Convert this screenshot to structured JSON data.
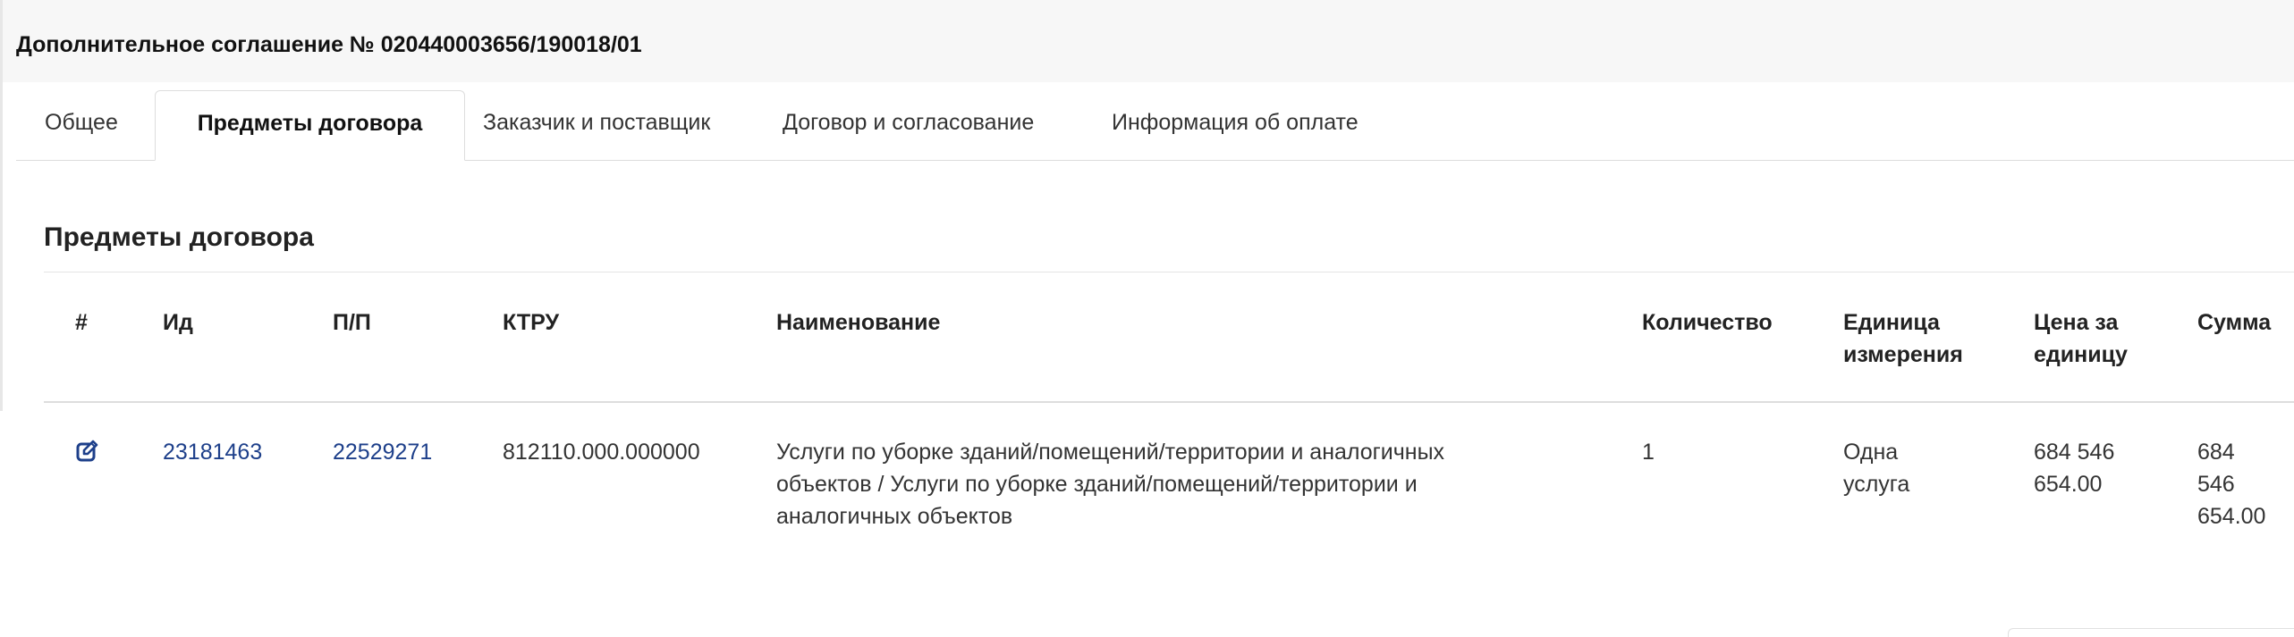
{
  "header": {
    "title": "Дополнительное соглашение № 020440003656/190018/01"
  },
  "tabs": [
    {
      "label": "Общее",
      "active": false
    },
    {
      "label": "Предметы договора",
      "active": true
    },
    {
      "label": "Заказчик и поставщик",
      "active": false
    },
    {
      "label": "Договор и согласование",
      "active": false
    },
    {
      "label": "Информация об оплате",
      "active": false
    }
  ],
  "section": {
    "title": "Предметы договора"
  },
  "table": {
    "columns": [
      "#",
      "Ид",
      "П/П",
      "КТРУ",
      "Наименование",
      "Количество",
      "Единица измерения",
      "Цена за единицу",
      "Сумма"
    ],
    "rows": [
      {
        "action_icon": "edit-icon",
        "id": "23181463",
        "pp": "22529271",
        "ktru": "812110.000.000000",
        "name": "Услуги по уборке зданий/помещений/территории и аналогичных объектов / Услуги по уборке зданий/помещений/территории и аналогичных объектов",
        "quantity": "1",
        "unit": "Одна услуга",
        "unit_price": "684 546 654.00",
        "total": "684 546 654.00"
      }
    ]
  },
  "colors": {
    "link": "#1d3f8a",
    "header_bg": "#f7f7f7",
    "border": "#dddddd"
  }
}
